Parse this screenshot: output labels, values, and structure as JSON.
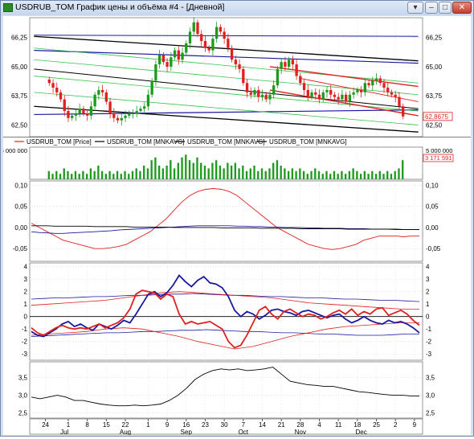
{
  "window": {
    "title": "USDRUB_TOM График цены и объёма #4 - [Дневной]",
    "buttons": {
      "menu": "▾",
      "minimize": "–",
      "maximize": "□",
      "close": "✕"
    }
  },
  "chart_data": [
    {
      "type": "candlestick",
      "name": "price",
      "y_ticks": [
        "66,25",
        "65,00",
        "63,75",
        "62,50"
      ],
      "y_tick_values": [
        66.25,
        65.0,
        63.75,
        62.5
      ],
      "ylim": [
        62.0,
        67.1
      ],
      "last_price_label": "62,8675",
      "last_price": 62.8675,
      "colors": {
        "up": "#1c9a1c",
        "down": "#e02020"
      },
      "closes": [
        64.3,
        64.1,
        63.9,
        63.6,
        63.1,
        62.8,
        62.9,
        63.0,
        63.2,
        63.0,
        62.9,
        63.3,
        63.8,
        64.0,
        63.9,
        63.5,
        63.0,
        62.8,
        62.7,
        62.8,
        62.9,
        63.0,
        63.0,
        63.1,
        63.2,
        63.3,
        63.8,
        64.4,
        65.1,
        65.5,
        65.2,
        65.0,
        65.4,
        65.7,
        65.3,
        65.6,
        66.0,
        66.5,
        66.9,
        66.4,
        66.1,
        65.8,
        65.7,
        66.2,
        66.7,
        66.5,
        66.2,
        65.8,
        65.3,
        65.1,
        64.9,
        64.3,
        63.9,
        63.8,
        64.0,
        63.7,
        63.8,
        63.6,
        63.8,
        64.2,
        64.9,
        65.2,
        65.0,
        65.3,
        65.1,
        64.6,
        64.3,
        64.0,
        63.7,
        63.9,
        63.8,
        63.6,
        63.9,
        64.0,
        63.8,
        63.7,
        63.6,
        63.8,
        63.5,
        63.8,
        63.9,
        64.0,
        63.9,
        64.3,
        64.2,
        64.4,
        64.5,
        64.3,
        64.1,
        63.9,
        63.8,
        63.7,
        63.3,
        62.87
      ],
      "volumes": [
        0.3,
        0.2,
        0.3,
        0.2,
        0.4,
        0.3,
        0.2,
        0.3,
        0.2,
        0.3,
        0.2,
        0.4,
        0.3,
        0.5,
        0.3,
        0.2,
        0.3,
        0.2,
        0.3,
        0.2,
        0.3,
        0.2,
        0.3,
        0.4,
        0.3,
        0.5,
        0.4,
        0.7,
        0.8,
        0.5,
        0.4,
        0.5,
        0.7,
        0.4,
        0.6,
        0.8,
        0.9,
        0.7,
        0.6,
        0.8,
        0.6,
        0.5,
        0.4,
        0.6,
        0.7,
        0.5,
        0.4,
        0.6,
        0.5,
        0.6,
        0.4,
        0.5,
        0.3,
        0.4,
        0.5,
        0.3,
        0.4,
        0.3,
        0.4,
        0.6,
        0.7,
        0.5,
        0.4,
        0.3,
        0.4,
        0.3,
        0.4,
        0.3,
        0.2,
        0.3,
        0.4,
        0.3,
        0.2,
        0.3,
        0.2,
        0.3,
        0.2,
        0.3,
        0.2,
        0.3,
        0.4,
        0.3,
        0.2,
        0.3,
        0.2,
        0.3,
        0.2,
        0.3,
        0.2,
        0.3,
        0.2,
        0.3,
        0.4,
        0.7
      ],
      "legend": [
        "USDRUB_TOM [Price]",
        "USDRUB_TOM [MNKAVG]",
        "USDRUB_TOM [MNKAVG]",
        "USDRUB_TOM [MNKAVG]"
      ],
      "x_tick_labels": [
        "24",
        "1",
        "8",
        "15",
        "22",
        "1",
        "9",
        "16",
        "23",
        "30",
        "7",
        "14",
        "21",
        "28",
        "4",
        "11",
        "18",
        "25",
        "2",
        "9"
      ],
      "x_tick_index": [
        3,
        9,
        14,
        19,
        24,
        30,
        35,
        40,
        45,
        50,
        55,
        60,
        65,
        70,
        75,
        80,
        85,
        90,
        95,
        100
      ],
      "month_labels": [
        "Jul",
        "Aug",
        "Sep",
        "Oct",
        "Nov",
        "Dec"
      ],
      "month_tick_index": [
        8,
        24,
        40,
        55,
        70,
        86
      ]
    },
    {
      "type": "bar",
      "name": "volume",
      "y_tick_label": "5 000 000",
      "last_label": "3 171 591",
      "color": "#1c9a1c"
    },
    {
      "type": "line",
      "name": "oscillator",
      "y_ticks": [
        "0,10",
        "0,05",
        "0,00",
        "-0,05"
      ],
      "y_tick_values": [
        0.1,
        0.05,
        0.0,
        -0.05
      ],
      "ylim": [
        -0.08,
        0.11
      ],
      "series": [
        {
          "color": "#e02020",
          "values": [
            0.01,
            0.0,
            -0.01,
            -0.02,
            -0.03,
            -0.035,
            -0.04,
            -0.045,
            -0.05,
            -0.05,
            -0.048,
            -0.045,
            -0.04,
            -0.03,
            -0.02,
            -0.01,
            0.005,
            0.02,
            0.04,
            0.06,
            0.075,
            0.085,
            0.09,
            0.092,
            0.09,
            0.085,
            0.075,
            0.06,
            0.045,
            0.03,
            0.015,
            0.0,
            -0.01,
            -0.02,
            -0.03,
            -0.04,
            -0.045,
            -0.05,
            -0.052,
            -0.05,
            -0.045,
            -0.04,
            -0.03,
            -0.025,
            -0.02,
            -0.02,
            -0.02,
            -0.022,
            -0.02,
            -0.02
          ]
        },
        {
          "color": "#1a1aa0",
          "values": [
            -0.01,
            -0.012,
            -0.013,
            -0.014,
            -0.014,
            -0.013,
            -0.012,
            -0.011,
            -0.01,
            -0.009,
            -0.008,
            -0.006,
            -0.005,
            -0.004,
            -0.003,
            -0.002,
            -0.001,
            0.0,
            0.001,
            0.002,
            0.003,
            0.004,
            0.004,
            0.004,
            0.004,
            0.004,
            0.003,
            0.003,
            0.002,
            0.002,
            0.001,
            0.001,
            0.0,
            0.0,
            0.0,
            -0.001,
            -0.001,
            -0.002,
            -0.002,
            -0.002,
            -0.003,
            -0.003,
            -0.003,
            -0.004,
            -0.004,
            -0.004,
            -0.005,
            -0.005,
            -0.005,
            -0.005
          ]
        },
        {
          "color": "#000000",
          "values": [
            0.004,
            0.004,
            0.004,
            0.003,
            0.003,
            0.003,
            0.003,
            0.003,
            0.002,
            0.002,
            0.002,
            0.002,
            0.002,
            0.001,
            0.001,
            0.001,
            0.001,
            0.001,
            0.0,
            0.0,
            0.0,
            0.0,
            0.0,
            0.0,
            -0.001,
            -0.001,
            -0.001,
            -0.001,
            -0.001,
            -0.002,
            -0.002,
            -0.002,
            -0.002,
            -0.002,
            -0.003,
            -0.003,
            -0.003,
            -0.003,
            -0.003,
            -0.003,
            -0.004,
            -0.004,
            -0.004,
            -0.004,
            -0.004,
            -0.004,
            -0.004,
            -0.005,
            -0.005,
            -0.005
          ]
        }
      ]
    },
    {
      "type": "line",
      "name": "z-score",
      "y_ticks": [
        "4",
        "3",
        "2",
        "1",
        "0",
        "-1",
        "-2",
        "-3"
      ],
      "y_tick_values": [
        4,
        3,
        2,
        1,
        0,
        -1,
        -2,
        -3
      ],
      "ylim": [
        -3.5,
        4.3
      ],
      "series": [
        {
          "color": "#1a1aa0",
          "width": 1.8,
          "values": [
            -1.2,
            -1.5,
            -1.6,
            -1.3,
            -1.0,
            -0.6,
            -0.4,
            -0.8,
            -0.6,
            -0.9,
            -1.1,
            -0.6,
            -0.8,
            -1.0,
            -0.7,
            -0.3,
            -0.5,
            0.2,
            1.0,
            1.8,
            2.0,
            1.6,
            1.9,
            2.5,
            3.3,
            2.8,
            2.4,
            2.9,
            3.2,
            2.7,
            2.6,
            2.3,
            1.6,
            0.5,
            0.0,
            0.4,
            0.2,
            -0.2,
            0.1,
            0.5,
            0.6,
            0.4,
            0.3,
            0.1,
            0.4,
            0.5,
            0.3,
            0.1,
            -0.1,
            0.1,
            0.2,
            -0.2,
            -0.5,
            -0.3,
            0.0,
            -0.3,
            -0.5,
            -0.6,
            -0.3,
            -0.5,
            -0.4,
            -0.6,
            -0.9,
            -1.3
          ]
        },
        {
          "color": "#e02020",
          "width": 1.8,
          "values": [
            -0.9,
            -1.3,
            -1.5,
            -1.2,
            -0.9,
            -0.7,
            -0.9,
            -1.0,
            -0.9,
            -1.0,
            -0.8,
            -0.6,
            -0.9,
            -0.7,
            -0.5,
            -0.1,
            0.6,
            1.8,
            2.1,
            2.0,
            1.9,
            1.4,
            1.8,
            1.6,
            0.2,
            -0.6,
            -0.4,
            -0.6,
            -0.5,
            -0.4,
            -0.7,
            -1.0,
            -2.0,
            -2.5,
            -2.3,
            -1.5,
            -0.5,
            0.5,
            0.8,
            0.2,
            -0.2,
            0.4,
            0.6,
            0.3,
            0.0,
            0.2,
            0.1,
            -0.2,
            0.0,
            0.3,
            0.5,
            0.2,
            0.6,
            0.1,
            0.4,
            0.2,
            0.6,
            0.7,
            0.1,
            0.3,
            0.5,
            0.2,
            -0.3,
            -0.7
          ]
        },
        {
          "color": "#1a1aa0",
          "width": 0.8,
          "values": [
            1.4,
            1.45,
            1.5,
            1.5,
            1.55,
            1.6,
            1.6,
            1.65,
            1.7,
            1.7,
            1.75,
            1.8,
            1.8,
            1.85,
            1.8,
            1.75,
            1.7,
            1.7,
            1.65,
            1.6,
            1.6,
            1.55,
            1.5,
            1.5,
            1.45,
            1.4,
            1.4,
            1.35,
            1.3,
            1.3,
            1.25,
            1.2
          ]
        },
        {
          "color": "#1a1aa0",
          "width": 0.8,
          "values": [
            -1.6,
            -1.55,
            -1.5,
            -1.45,
            -1.4,
            -1.35,
            -1.3,
            -1.3,
            -1.25,
            -1.2,
            -1.2,
            -1.15,
            -1.1,
            -1.1,
            -1.05,
            -1.1,
            -1.15,
            -1.2,
            -1.2,
            -1.25,
            -1.3,
            -1.3,
            -1.35,
            -1.4,
            -1.4,
            -1.45,
            -1.5,
            -1.5,
            -1.5,
            -1.45,
            -1.4,
            -1.4
          ]
        },
        {
          "color": "#e02020",
          "width": 0.8,
          "values": [
            0.9,
            1.0,
            1.1,
            1.2,
            1.3,
            1.5,
            1.7,
            1.9,
            2.0,
            1.9,
            1.8,
            1.7,
            1.6,
            1.5,
            1.3,
            1.1,
            1.0,
            0.9,
            0.8,
            0.7,
            0.6,
            0.6
          ]
        },
        {
          "color": "#e02020",
          "width": 0.8,
          "values": [
            -1.5,
            -1.4,
            -1.3,
            -1.2,
            -1.0,
            -0.9,
            -1.0,
            -1.3,
            -1.6,
            -2.0,
            -2.3,
            -2.6,
            -2.4,
            -2.0,
            -1.6,
            -1.3,
            -1.0,
            -0.8,
            -0.7,
            -0.6,
            -0.5,
            -0.5
          ]
        }
      ]
    },
    {
      "type": "line",
      "name": "ratio",
      "y_ticks": [
        "3,5",
        "3,0",
        "2,5"
      ],
      "y_tick_values": [
        3.5,
        3.0,
        2.5
      ],
      "ylim": [
        2.35,
        3.95
      ],
      "series": [
        {
          "color": "#000000",
          "values": [
            2.95,
            2.9,
            2.95,
            3.0,
            2.95,
            2.85,
            2.85,
            2.8,
            2.75,
            2.72,
            2.7,
            2.7,
            2.72,
            2.7,
            2.72,
            2.75,
            2.85,
            3.0,
            3.2,
            3.45,
            3.6,
            3.7,
            3.75,
            3.72,
            3.75,
            3.7,
            3.72,
            3.75,
            3.8,
            3.6,
            3.4,
            3.35,
            3.3,
            3.28,
            3.25,
            3.25,
            3.2,
            3.15,
            3.1,
            3.08,
            3.05,
            3.02,
            3.0,
            3.0,
            2.98,
            2.98
          ]
        }
      ]
    }
  ]
}
